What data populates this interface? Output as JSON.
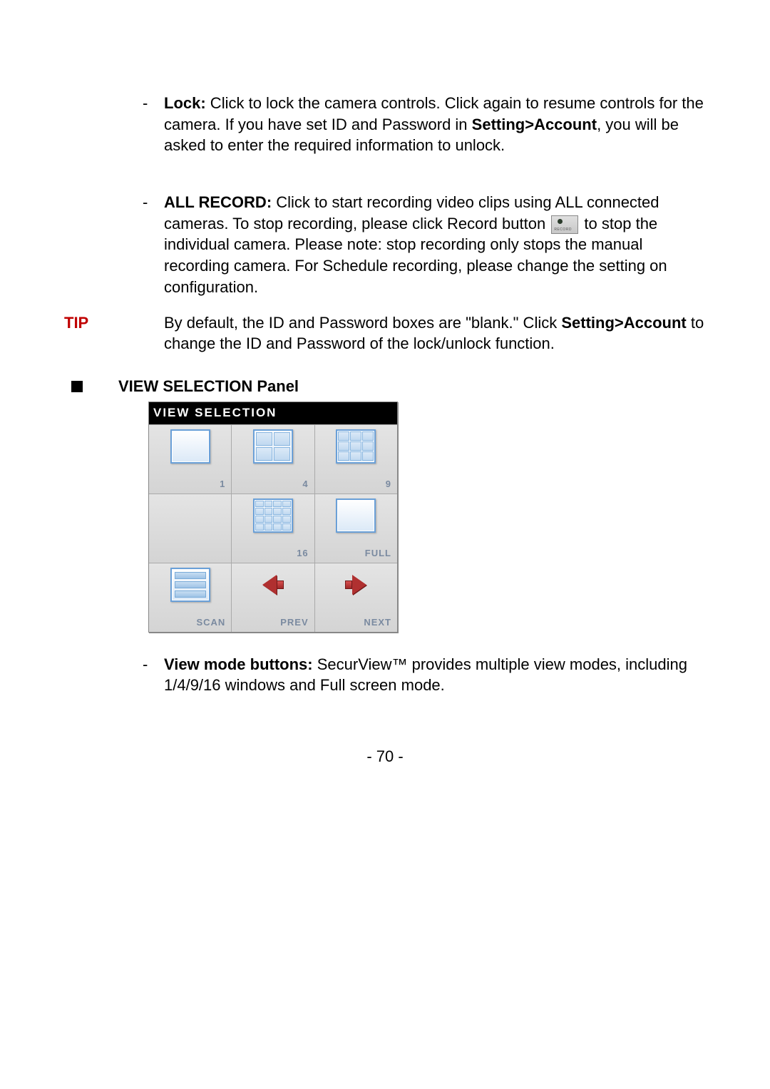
{
  "lock": {
    "label": "Lock:",
    "text1": "  Click to lock the camera controls.  Click again to resume controls for the camera.  If you have set ID and Password in ",
    "path": "Setting>Account",
    "text2": ", you will be asked to enter the required information to unlock."
  },
  "allrec": {
    "label": "ALL RECORD:",
    "text1": "  Click to start recording video clips using ALL connected cameras.  To stop recording, please click Record button ",
    "text2": " to stop the individual camera.  Please note:  stop recording only stops the manual recording camera.  For Schedule recording, please change the setting on configuration."
  },
  "tip": {
    "label": "TIP",
    "t1": "By default, the ID and Password boxes are \"blank.\" Click ",
    "path": "Setting>Account",
    "t2": " to change the ID and Password of the lock/unlock function."
  },
  "section": "VIEW SELECTION Panel",
  "panel": {
    "title": "VIEW SELECTION",
    "btn1": "1",
    "btn4": "4",
    "btn9": "9",
    "btn16": "16",
    "btnFull": "FULL",
    "btnScan": "SCAN",
    "btnPrev": "PREV",
    "btnNext": "NEXT"
  },
  "viewmode": {
    "label": "View mode buttons:",
    "text": "  SecurView™ provides multiple view modes, including 1/4/9/16 windows and Full screen mode."
  },
  "pageNum": "- 70 -"
}
